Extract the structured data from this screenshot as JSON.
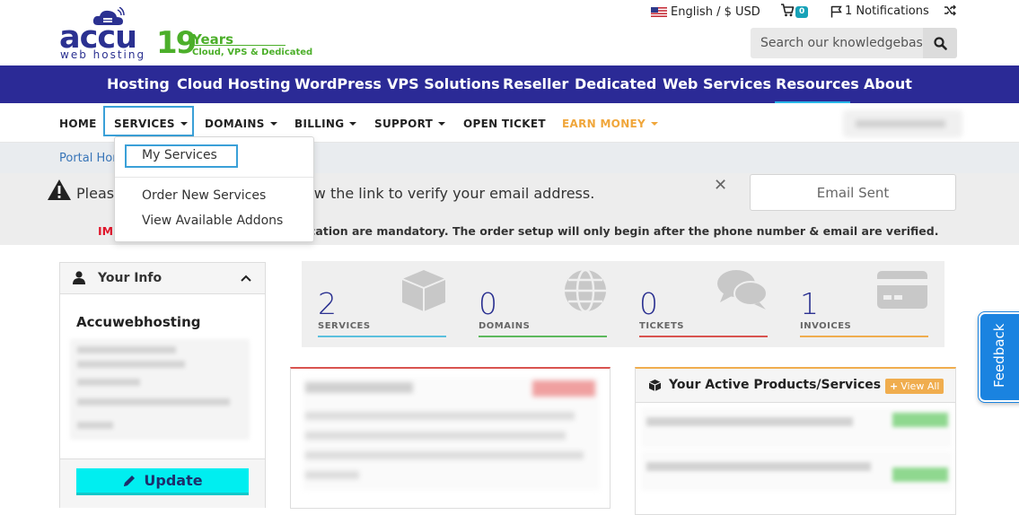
{
  "header": {
    "language_currency": "English / $ USD",
    "cart_count": "0",
    "notifications": "1 Notifications",
    "search_placeholder": "Search our knowledgebase...",
    "logo": {
      "brand": "accu",
      "tagline": "web hosting",
      "years_num": "19",
      "years": "Years",
      "sub": "Cloud, VPS & Dedicated"
    }
  },
  "main_nav": [
    "Hosting",
    "Cloud Hosting",
    "WordPress",
    "VPS Solutions",
    "Reseller",
    "Dedicated",
    "Web Services",
    "Resources",
    "About"
  ],
  "sub_nav": {
    "home": "HOME",
    "services": "SERVICES",
    "domains": "DOMAINS",
    "billing": "BILLING",
    "support": "SUPPORT",
    "open_ticket": "OPEN TICKET",
    "earn_money": "EARN MONEY"
  },
  "dropdown": {
    "my_services": "My Services",
    "order_new": "Order New Services",
    "view_addons": "View Available Addons"
  },
  "breadcrumb": "Portal Home",
  "alert": {
    "message_start": "Please",
    "message_end": "ow the link to verify your email address.",
    "email_sent": "Email Sent",
    "important_label": "IMP",
    "important_text": "cation are mandatory. The order setup will only begin after the phone number & email are verified."
  },
  "your_info": {
    "title": "Your Info",
    "name": "Accuwebhosting",
    "update": "Update"
  },
  "stats": [
    {
      "value": "2",
      "label": "SERVICES",
      "color": "#5bc0de"
    },
    {
      "value": "0",
      "label": "DOMAINS",
      "color": "#5cb85c"
    },
    {
      "value": "0",
      "label": "TICKETS",
      "color": "#d9534f"
    },
    {
      "value": "1",
      "label": "INVOICES",
      "color": "#f0ad4e"
    }
  ],
  "products": {
    "title": "Your Active Products/Services",
    "view_all": "View All"
  },
  "feedback": "Feedback",
  "colors": {
    "nav_bg": "#2b2a96",
    "brand_blue": "#2b3191",
    "brand_green": "#4caf2a",
    "accent_orange": "#f0a63a",
    "update_btn": "#00eef0"
  }
}
